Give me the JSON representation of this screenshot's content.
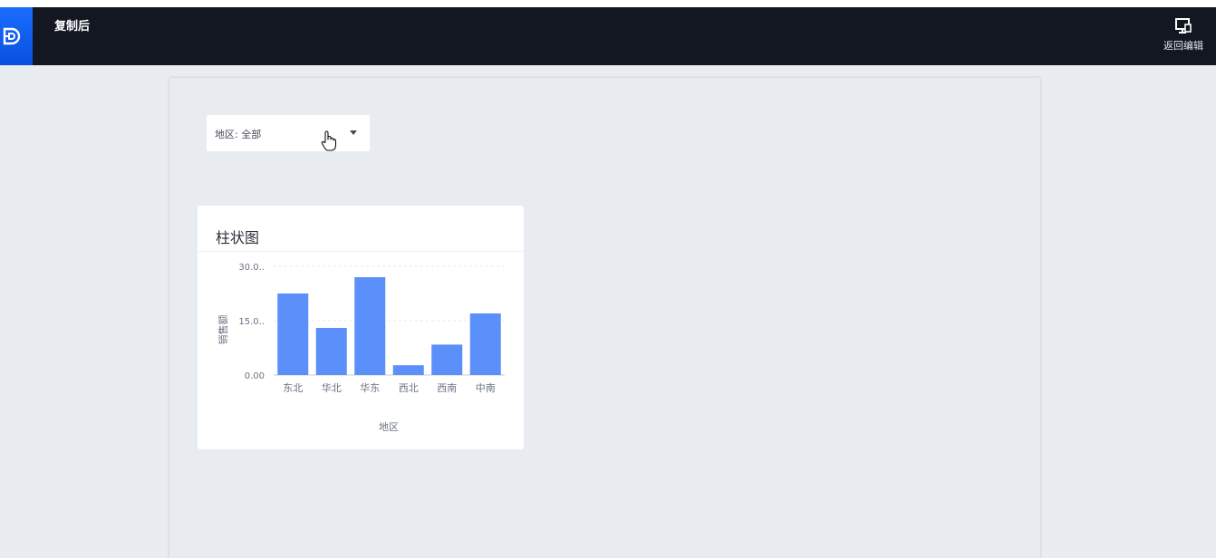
{
  "header": {
    "title": "复制后",
    "back_label": "返回编辑"
  },
  "filter": {
    "label": "地区: 全部"
  },
  "chart": {
    "title": "柱状图"
  },
  "colors": {
    "topbar": "#131722",
    "logo": "#0a4fe0",
    "bar": "#5b8ff9"
  },
  "chart_data": {
    "type": "bar",
    "title": "柱状图",
    "xlabel": "地区",
    "ylabel": "销售额",
    "categories": [
      "东北",
      "华北",
      "华东",
      "西北",
      "西南",
      "中南"
    ],
    "values": [
      22.5,
      13.0,
      27.0,
      2.7,
      8.4,
      17.0
    ],
    "ylim": [
      0,
      30
    ],
    "yticks": [
      "0.00",
      "15.0..",
      "30.0.."
    ],
    "ytick_values": [
      0,
      15,
      30
    ],
    "grid": true,
    "legend": "none"
  }
}
